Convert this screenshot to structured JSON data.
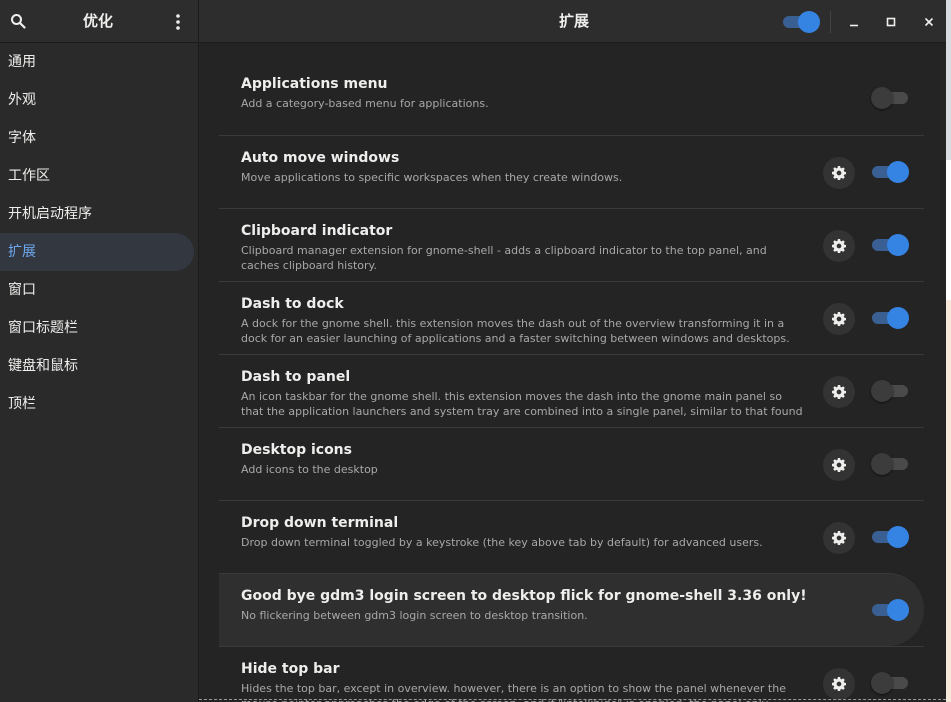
{
  "sidebar": {
    "title": "优化",
    "search_icon": "search-icon",
    "menu_icon": "vertical-dots-icon",
    "items": [
      {
        "label": "通用",
        "active": false
      },
      {
        "label": "外观",
        "active": false
      },
      {
        "label": "字体",
        "active": false
      },
      {
        "label": "工作区",
        "active": false
      },
      {
        "label": "开机启动程序",
        "active": false
      },
      {
        "label": "扩展",
        "active": true
      },
      {
        "label": "窗口",
        "active": false
      },
      {
        "label": "窗口标题栏",
        "active": false
      },
      {
        "label": "键盘和鼠标",
        "active": false
      },
      {
        "label": "顶栏",
        "active": false
      }
    ]
  },
  "header": {
    "title": "扩展",
    "extensions_enabled": true,
    "window_controls": [
      "minimize-icon",
      "maximize-icon",
      "close-icon"
    ]
  },
  "extensions": [
    {
      "title": "Applications menu",
      "description": "Add a category-based menu for applications.",
      "has_settings": false,
      "enabled": false
    },
    {
      "title": "Auto move windows",
      "description": "Move applications to specific workspaces when they create windows.",
      "has_settings": true,
      "enabled": true
    },
    {
      "title": "Clipboard indicator",
      "description": "Clipboard manager extension for gnome-shell - adds a clipboard indicator to the top panel, and caches clipboard history.",
      "has_settings": true,
      "enabled": true
    },
    {
      "title": "Dash to dock",
      "description": "A dock for the gnome shell. this extension moves the dash out of the overview transforming it in a dock for an easier launching of applications and a faster switching between windows and desktops. s…",
      "has_settings": true,
      "enabled": true
    },
    {
      "title": "Dash to panel",
      "description": "An icon taskbar for the gnome shell. this extension moves the dash into the gnome main panel so that the application launchers and system tray are combined into a single panel, similar to that found in k…",
      "has_settings": true,
      "enabled": false
    },
    {
      "title": "Desktop icons",
      "description": "Add icons to the desktop",
      "has_settings": true,
      "enabled": false
    },
    {
      "title": "Drop down terminal",
      "description": "Drop down terminal toggled by a keystroke (the key above tab by default) for advanced users.",
      "has_settings": true,
      "enabled": true
    },
    {
      "title": "Good bye gdm3 login screen to desktop flick for gnome-shell 3.36 only!",
      "description": "No flickering between gdm3 login screen to desktop transition.",
      "has_settings": false,
      "enabled": true,
      "highlighted": true
    },
    {
      "title": "Hide top bar",
      "description": "Hides the top bar, except in overview. however, there is an option to show the panel whenever the mouse pointer approaches the edge of the screen. and if \"intellihide\" is enabled, the panel only hide…",
      "has_settings": true,
      "enabled": false
    }
  ],
  "colors": {
    "accent": "#3584e4",
    "window_bg": "#242424",
    "sidebar_bg": "#2a2a2a",
    "active_text": "#6ea8ee"
  }
}
